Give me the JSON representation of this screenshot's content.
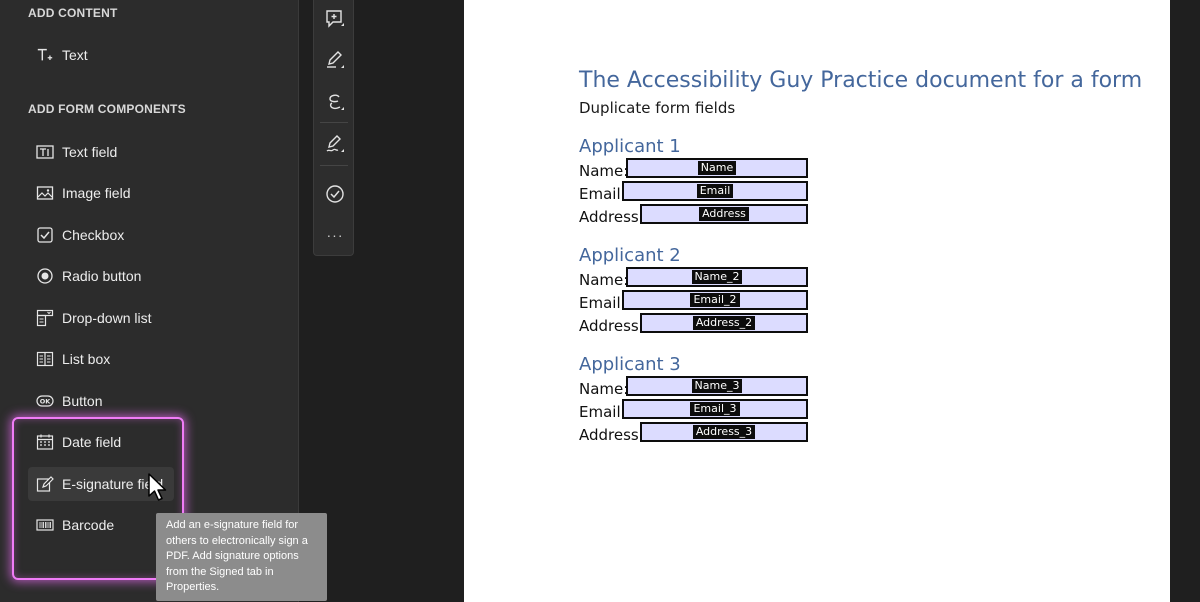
{
  "left_panel": {
    "add_content_title": "ADD CONTENT",
    "text_tool": {
      "label": "Text",
      "icon": "text-add-icon"
    },
    "add_form_components_title": "ADD FORM COMPONENTS",
    "items": [
      {
        "label": "Text field",
        "icon": "text-field-icon"
      },
      {
        "label": "Image field",
        "icon": "image-icon"
      },
      {
        "label": "Checkbox",
        "icon": "checkbox-icon"
      },
      {
        "label": "Radio button",
        "icon": "radio-button-icon"
      },
      {
        "label": "Drop-down list",
        "icon": "dropdown-list-icon"
      },
      {
        "label": "List box",
        "icon": "list-box-icon"
      },
      {
        "label": "Button",
        "icon": "ok-button-icon"
      },
      {
        "label": "Date field",
        "icon": "calendar-icon"
      },
      {
        "label": "E-signature field",
        "icon": "signature-pen-icon"
      },
      {
        "label": "Barcode",
        "icon": "barcode-icon"
      }
    ],
    "hovered_item": "E-signature field",
    "highlight_color": "#f07cf7"
  },
  "tooltip": {
    "lines": [
      "Add an e-signature field for",
      "others to electronically sign a",
      "PDF. Add signature options",
      "from the Signed tab in",
      "Properties."
    ]
  },
  "toolbar": {
    "tools": [
      "comment-add-icon",
      "pen-highlight-icon",
      "lasso-draw-icon",
      "sign-pen-icon",
      "check-circle-icon"
    ],
    "more_label": "···"
  },
  "document": {
    "title": "The Accessibility Guy Practice document for a form",
    "subtitle": "Duplicate form fields",
    "applicants": [
      {
        "heading": "Applicant 1",
        "fields": [
          {
            "label": "Name:",
            "value": "Name"
          },
          {
            "label": "Email:",
            "value": "Email"
          },
          {
            "label": "Address:",
            "value": "Address"
          }
        ]
      },
      {
        "heading": "Applicant 2",
        "fields": [
          {
            "label": "Name:",
            "value": "Name_2"
          },
          {
            "label": "Email:",
            "value": "Email_2"
          },
          {
            "label": "Address:",
            "value": "Address_2"
          }
        ]
      },
      {
        "heading": "Applicant 3",
        "fields": [
          {
            "label": "Name:",
            "value": "Name_3"
          },
          {
            "label": "Email:",
            "value": "Email_3"
          },
          {
            "label": "Address:",
            "value": "Address_3"
          }
        ]
      }
    ],
    "field_fill_color": "#dcdcff",
    "heading_color": "#44679c"
  }
}
